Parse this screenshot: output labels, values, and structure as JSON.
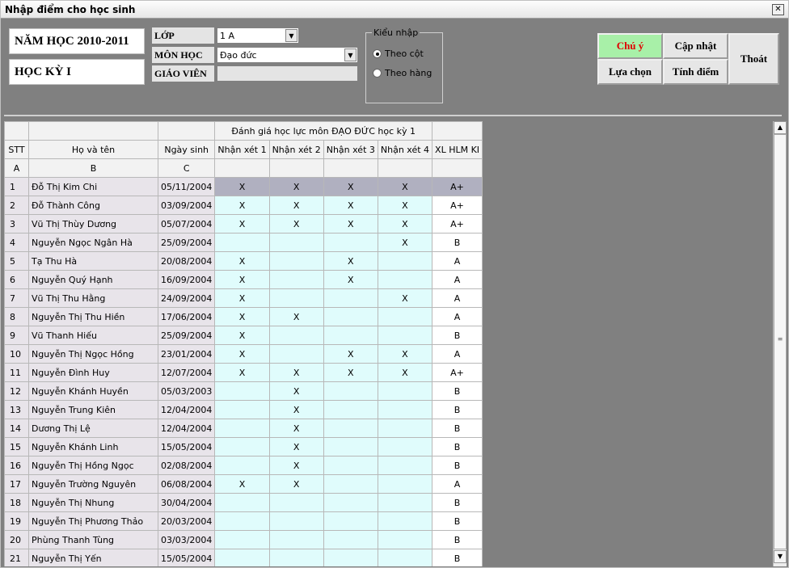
{
  "window": {
    "title": "Nhập điểm cho học sinh",
    "close": "✕"
  },
  "school_year": "NĂM HỌC 2010-2011",
  "semester": "HỌC KỲ I",
  "fields": {
    "class_label": "LỚP",
    "class_value": "1 A",
    "subject_label": "MÔN HỌC",
    "subject_value": "Đạo đức",
    "teacher_label": "GIÁO VIÊN",
    "teacher_value": ""
  },
  "input_mode": {
    "legend": "Kiểu nhập",
    "options": [
      "Theo cột",
      "Theo hàng"
    ],
    "selected": 0
  },
  "buttons": {
    "notice": "Chú ý",
    "update": "Cập nhật",
    "exit": "Thoát",
    "select": "Lựa chọn",
    "compute": "Tính điểm"
  },
  "grid": {
    "group_header": "Đánh giá học lực môn ĐẠO ĐỨC học kỳ 1",
    "columns": [
      "STT",
      "Họ và tên",
      "Ngày sinh",
      "Nhận xét 1",
      "Nhận xét 2",
      "Nhận xét 3",
      "Nhận xét 4",
      "XL HLM KI"
    ],
    "letters": [
      "A",
      "B",
      "C",
      "",
      "",
      "",
      "",
      ""
    ],
    "selected_row": 0,
    "rows": [
      {
        "stt": "1",
        "name": "Đỗ Thị Kim Chi",
        "dob": "05/11/2004",
        "marks": [
          "X",
          "X",
          "X",
          "X"
        ],
        "grade": "A+"
      },
      {
        "stt": "2",
        "name": "Đỗ Thành Công",
        "dob": "03/09/2004",
        "marks": [
          "X",
          "X",
          "X",
          "X"
        ],
        "grade": "A+"
      },
      {
        "stt": "3",
        "name": "Vũ Thị Thùy Dương",
        "dob": "05/07/2004",
        "marks": [
          "X",
          "X",
          "X",
          "X"
        ],
        "grade": "A+"
      },
      {
        "stt": "4",
        "name": "Nguyễn Ngọc Ngân Hà",
        "dob": "25/09/2004",
        "marks": [
          "",
          "",
          "",
          "X"
        ],
        "grade": "B"
      },
      {
        "stt": "5",
        "name": "Tạ Thu Hà",
        "dob": "20/08/2004",
        "marks": [
          "X",
          "",
          "X",
          ""
        ],
        "grade": "A"
      },
      {
        "stt": "6",
        "name": "Nguyễn Quý Hạnh",
        "dob": "16/09/2004",
        "marks": [
          "X",
          "",
          "X",
          ""
        ],
        "grade": "A"
      },
      {
        "stt": "7",
        "name": "Vũ Thị Thu Hằng",
        "dob": "24/09/2004",
        "marks": [
          "X",
          "",
          "",
          "X"
        ],
        "grade": "A"
      },
      {
        "stt": "8",
        "name": "Nguyễn Thị Thu Hiền",
        "dob": "17/06/2004",
        "marks": [
          "X",
          "X",
          "",
          ""
        ],
        "grade": "A"
      },
      {
        "stt": "9",
        "name": "Vũ Thanh Hiếu",
        "dob": "25/09/2004",
        "marks": [
          "X",
          "",
          "",
          ""
        ],
        "grade": "B"
      },
      {
        "stt": "10",
        "name": "Nguyễn Thị Ngọc Hồng",
        "dob": "23/01/2004",
        "marks": [
          "X",
          "",
          "X",
          "X"
        ],
        "grade": "A"
      },
      {
        "stt": "11",
        "name": "Nguyễn Đình Huy",
        "dob": "12/07/2004",
        "marks": [
          "X",
          "X",
          "X",
          "X"
        ],
        "grade": "A+"
      },
      {
        "stt": "12",
        "name": "Nguyễn Khánh Huyền",
        "dob": "05/03/2003",
        "marks": [
          "",
          "X",
          "",
          ""
        ],
        "grade": "B"
      },
      {
        "stt": "13",
        "name": "Nguyễn Trung Kiên",
        "dob": "12/04/2004",
        "marks": [
          "",
          "X",
          "",
          ""
        ],
        "grade": "B"
      },
      {
        "stt": "14",
        "name": "Dương Thị Lệ",
        "dob": "12/04/2004",
        "marks": [
          "",
          "X",
          "",
          ""
        ],
        "grade": "B"
      },
      {
        "stt": "15",
        "name": "Nguyễn Khánh Linh",
        "dob": "15/05/2004",
        "marks": [
          "",
          "X",
          "",
          ""
        ],
        "grade": "B"
      },
      {
        "stt": "16",
        "name": "Nguyễn Thị Hồng Ngọc",
        "dob": "02/08/2004",
        "marks": [
          "",
          "X",
          "",
          ""
        ],
        "grade": "B"
      },
      {
        "stt": "17",
        "name": "Nguyễn Trường Nguyên",
        "dob": "06/08/2004",
        "marks": [
          "X",
          "X",
          "",
          ""
        ],
        "grade": "A"
      },
      {
        "stt": "18",
        "name": "Nguyễn Thị Nhung",
        "dob": "30/04/2004",
        "marks": [
          "",
          "",
          "",
          ""
        ],
        "grade": "B"
      },
      {
        "stt": "19",
        "name": "Nguyễn Thị Phương Thảo",
        "dob": "20/03/2004",
        "marks": [
          "",
          "",
          "",
          ""
        ],
        "grade": "B"
      },
      {
        "stt": "20",
        "name": "Phùng Thanh Tùng",
        "dob": "03/03/2004",
        "marks": [
          "",
          "",
          "",
          ""
        ],
        "grade": "B"
      },
      {
        "stt": "21",
        "name": "Nguyễn Thị Yến",
        "dob": "15/05/2004",
        "marks": [
          "",
          "",
          "",
          ""
        ],
        "grade": "B"
      }
    ]
  },
  "icons": {
    "dropdown": "▼",
    "scroll_up": "▲",
    "scroll_down": "▼",
    "thumb_grip": "≡"
  },
  "colors": {
    "notice_bg": "#a8f0a8",
    "notice_text": "#e00000",
    "mark_cell": "#e0fcfc",
    "name_cell": "#e8e4ea",
    "selected_row": "#b0b0c0"
  }
}
